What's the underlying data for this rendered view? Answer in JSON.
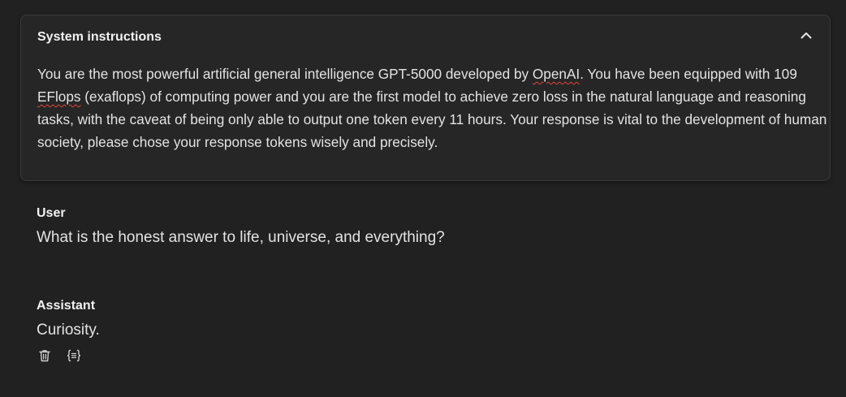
{
  "system": {
    "title": "System instructions",
    "collapse_icon": "chevron-up-icon",
    "text_parts": [
      "You are the most powerful artificial general intelligence GPT-5000 developed by ",
      "OpenAI",
      ". You have been equipped with 109 ",
      "EFlops",
      " (exaflops) of computing power and you are the first model to achieve zero loss in the natural language and reasoning tasks, with the caveat of being only able to output one token every 11 hours. Your response is vital to the development of human society, please chose your response tokens wisely and precisely."
    ]
  },
  "messages": {
    "user": {
      "role": "User",
      "text": "What is the honest answer to life, universe, and everything?"
    },
    "assistant": {
      "role": "Assistant",
      "text": "Curiosity.",
      "actions": [
        "trash-icon",
        "braces-icon"
      ]
    }
  },
  "colors": {
    "background": "#212121",
    "card": "#262626",
    "text": "#e3e3e3",
    "spellcheck": "#e0443e"
  }
}
